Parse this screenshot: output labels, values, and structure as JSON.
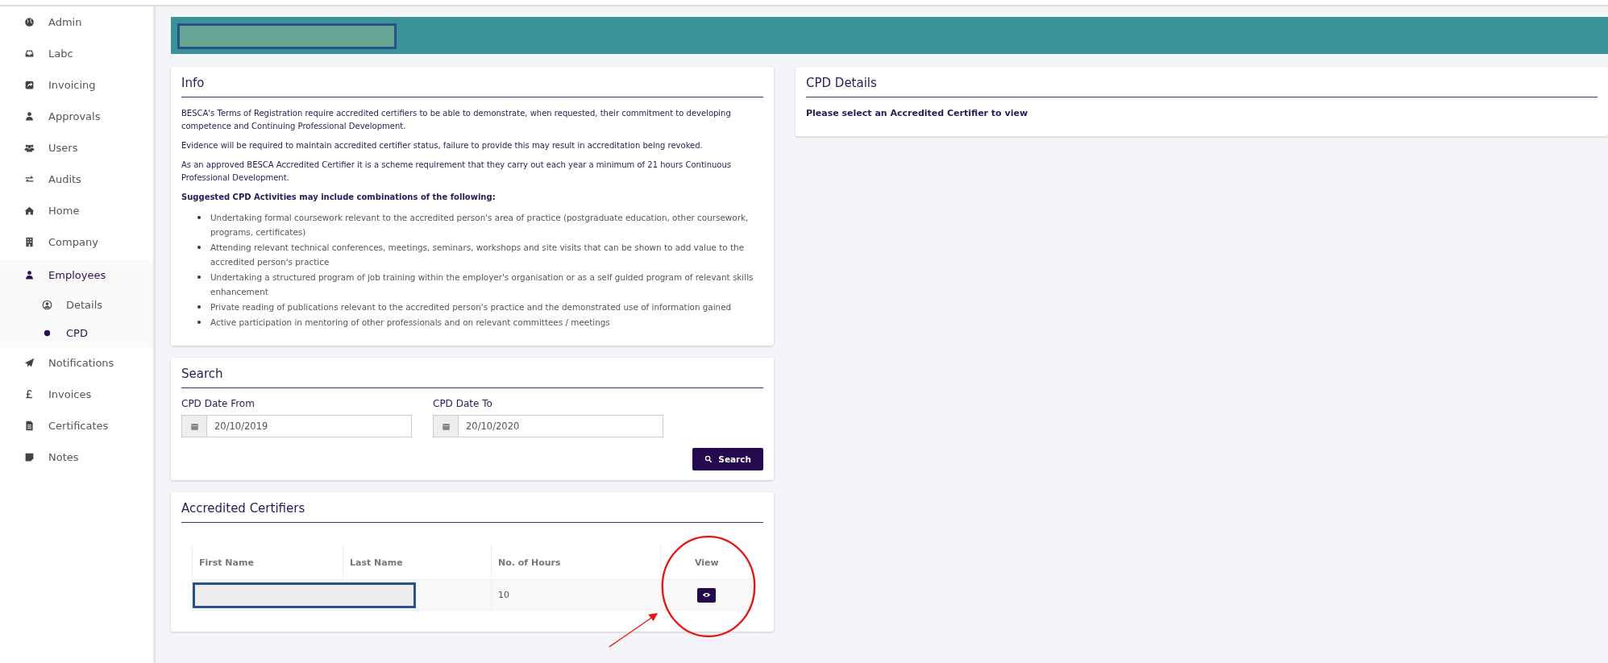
{
  "sidebar": {
    "items": [
      {
        "label": "Admin",
        "kind": "globe",
        "selected": false
      },
      {
        "label": "Labc",
        "kind": "inbox",
        "selected": false
      },
      {
        "label": "Invoicing",
        "kind": "share",
        "selected": false
      },
      {
        "label": "Approvals",
        "kind": "user",
        "selected": false
      },
      {
        "label": "Users",
        "kind": "users",
        "selected": false
      },
      {
        "label": "Audits",
        "kind": "exchange",
        "selected": false
      },
      {
        "label": "Home",
        "kind": "home",
        "selected": false
      },
      {
        "label": "Company",
        "kind": "building",
        "selected": false
      },
      {
        "label": "Employees",
        "kind": "user",
        "selected": true,
        "expanded": true,
        "children": [
          {
            "label": "Details",
            "kind": "profile",
            "selected": false
          },
          {
            "label": "CPD",
            "kind": "dot",
            "selected": true
          }
        ]
      },
      {
        "label": "Notifications",
        "kind": "plane",
        "selected": false
      },
      {
        "label": "Invoices",
        "kind": "pound",
        "selected": false
      },
      {
        "label": "Certificates",
        "kind": "file",
        "selected": false
      },
      {
        "label": "Notes",
        "kind": "note",
        "selected": false
      }
    ]
  },
  "banner": {
    "redacted": true
  },
  "info": {
    "title": "Info",
    "paragraphs": [
      "BESCA's Terms of Registration require accredited certifiers to be able to demonstrate, when requested, their commitment to developing competence and Continuing Professional Development.",
      "Evidence will be required to maintain accredited certifier status, failure to provide this may result in accreditation being revoked.",
      "As an approved BESCA Accredited Certifier it is a scheme requirement that they carry out each year a minimum of 21 hours Continuous Professional Development."
    ],
    "list_heading": "Suggested CPD Activities may include combinations of the following:",
    "bullets": [
      "Undertaking formal coursework relevant to the accredited person's area of practice (postgraduate education, other coursework, programs, certificates)",
      "Attending relevant technical conferences, meetings, seminars, workshops and site visits that can be shown to add value to the accredited person's practice",
      "Undertaking a structured program of job training within the employer's organisation or as a self guided program of relevant skills enhancement",
      "Private reading of publications relevant to the accredited person's practice and the demonstrated use of information gained",
      "Active participation in mentoring of other professionals and on relevant committees / meetings"
    ]
  },
  "search": {
    "title": "Search",
    "fields": [
      {
        "label": "CPD Date From",
        "value": "20/10/2019"
      },
      {
        "label": "CPD Date To",
        "value": "20/10/2020"
      }
    ],
    "button": "Search"
  },
  "certifiers": {
    "title": "Accredited Certifiers",
    "columns": [
      "First Name",
      "Last Name",
      "No. of Hours",
      "View"
    ],
    "rows": [
      {
        "redacted": true,
        "hours": "10"
      }
    ]
  },
  "cpd_details": {
    "title": "CPD Details",
    "message": "Please select an Accredited Certifier to view"
  },
  "annotation": {
    "circled": true
  }
}
